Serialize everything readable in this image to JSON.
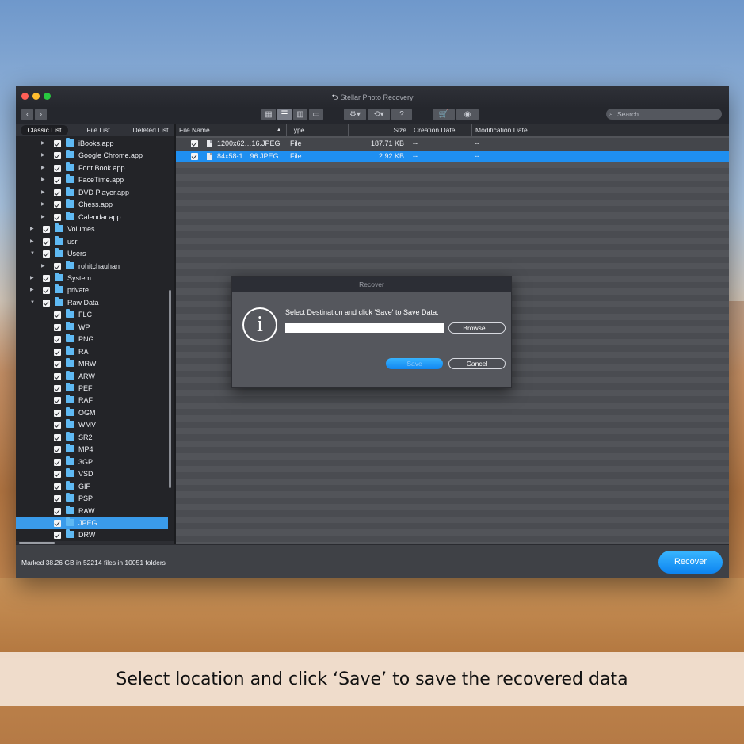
{
  "window": {
    "title": "Stellar Photo Recovery"
  },
  "toolbar": {
    "back_icon": "chevron-left-icon",
    "forward_icon": "chevron-right-icon",
    "help_label": "?",
    "search_placeholder": "Search"
  },
  "left_tabs": [
    "Classic List",
    "File List",
    "Deleted List"
  ],
  "tree": [
    {
      "label": "iBooks.app",
      "level": 2,
      "arrow": "right"
    },
    {
      "label": "Google Chrome.app",
      "level": 2,
      "arrow": "right"
    },
    {
      "label": "Font Book.app",
      "level": 2,
      "arrow": "right"
    },
    {
      "label": "FaceTime.app",
      "level": 2,
      "arrow": "right"
    },
    {
      "label": "DVD Player.app",
      "level": 2,
      "arrow": "right"
    },
    {
      "label": "Chess.app",
      "level": 2,
      "arrow": "right"
    },
    {
      "label": "Calendar.app",
      "level": 2,
      "arrow": "right"
    },
    {
      "label": "Volumes",
      "level": 1,
      "arrow": "right"
    },
    {
      "label": "usr",
      "level": 1,
      "arrow": "right"
    },
    {
      "label": "Users",
      "level": 1,
      "arrow": "down"
    },
    {
      "label": "rohitchauhan",
      "level": 2,
      "arrow": "right"
    },
    {
      "label": "System",
      "level": 1,
      "arrow": "right"
    },
    {
      "label": "private",
      "level": 1,
      "arrow": "right"
    },
    {
      "label": "Raw Data",
      "level": 1,
      "arrow": "down"
    },
    {
      "label": "FLC",
      "level": 2,
      "arrow": ""
    },
    {
      "label": "WP",
      "level": 2,
      "arrow": ""
    },
    {
      "label": "PNG",
      "level": 2,
      "arrow": ""
    },
    {
      "label": "RA",
      "level": 2,
      "arrow": ""
    },
    {
      "label": "MRW",
      "level": 2,
      "arrow": ""
    },
    {
      "label": "ARW",
      "level": 2,
      "arrow": ""
    },
    {
      "label": "PEF",
      "level": 2,
      "arrow": ""
    },
    {
      "label": "RAF",
      "level": 2,
      "arrow": ""
    },
    {
      "label": "OGM",
      "level": 2,
      "arrow": ""
    },
    {
      "label": "WMV",
      "level": 2,
      "arrow": ""
    },
    {
      "label": "SR2",
      "level": 2,
      "arrow": ""
    },
    {
      "label": "MP4",
      "level": 2,
      "arrow": ""
    },
    {
      "label": "3GP",
      "level": 2,
      "arrow": ""
    },
    {
      "label": "VSD",
      "level": 2,
      "arrow": ""
    },
    {
      "label": "GIF",
      "level": 2,
      "arrow": ""
    },
    {
      "label": "PSP",
      "level": 2,
      "arrow": ""
    },
    {
      "label": "RAW",
      "level": 2,
      "arrow": ""
    },
    {
      "label": "JPEG",
      "level": 2,
      "arrow": "",
      "selected": true
    },
    {
      "label": "DRW",
      "level": 2,
      "arrow": ""
    }
  ],
  "columns": [
    "File Name",
    "Type",
    "Size",
    "Creation Date",
    "Modification Date"
  ],
  "files": [
    {
      "name": "1200x62…16.JPEG",
      "type": "File",
      "size": "187.71 KB",
      "created": "--",
      "modified": "--",
      "selected": false
    },
    {
      "name": "84x58-1…96.JPEG",
      "type": "File",
      "size": "2.92 KB",
      "created": "--",
      "modified": "--",
      "selected": true
    }
  ],
  "status": {
    "text": "Marked 38.26 GB in 52214 files in 10051 folders",
    "recover_label": "Recover"
  },
  "dialog": {
    "title": "Recover",
    "message": "Select Destination and click 'Save' to Save Data.",
    "destination_value": "",
    "browse_label": "Browse...",
    "save_label": "Save",
    "cancel_label": "Cancel",
    "icon": "info-icon"
  },
  "caption": "Select location and click ‘Save’ to save the recovered data"
}
